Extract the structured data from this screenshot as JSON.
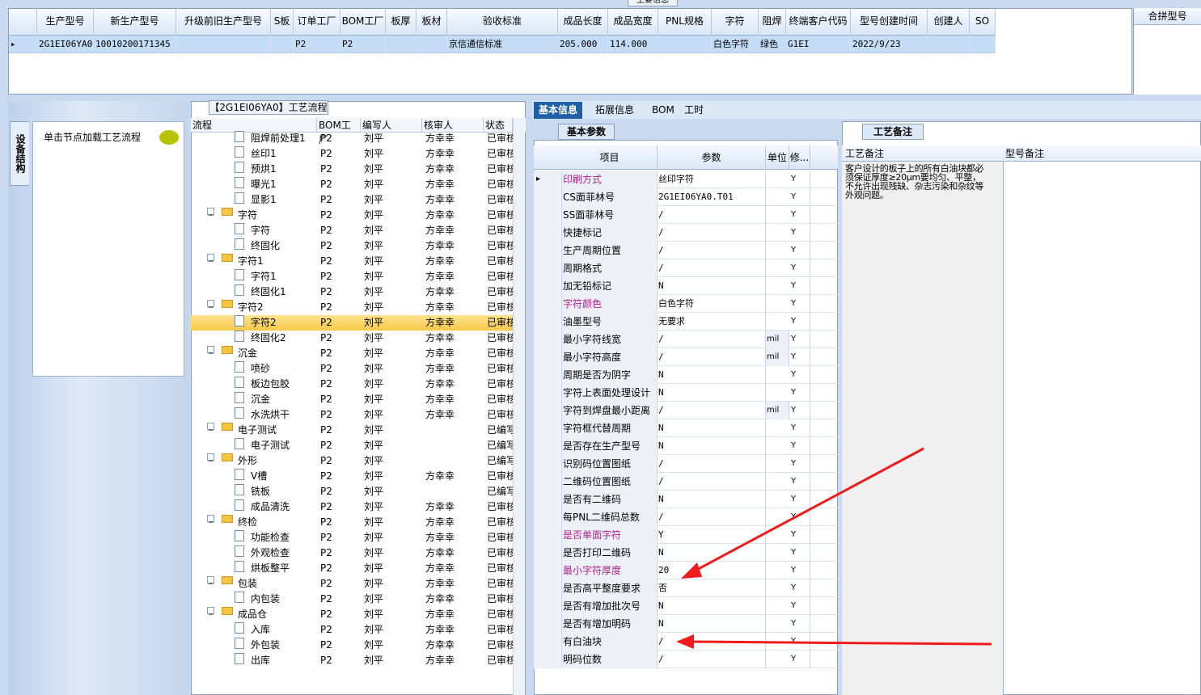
{
  "top_tab": "主要信息",
  "top_grid": {
    "columns": [
      "生产型号",
      "新生产型号",
      "升级前旧生产型号",
      "S板",
      "订单工厂",
      "BOM工厂",
      "板厚",
      "板材",
      "验收标准",
      "成品长度",
      "成品宽度",
      "PNL规格",
      "字符",
      "阻焊",
      "终端客户代码",
      "型号创建时间",
      "创建人",
      "SO"
    ],
    "row": [
      "2G1EI06YA0",
      "10010200171345",
      "",
      "",
      "P2",
      "P2",
      "",
      "",
      "京信通信标准",
      "205.000",
      "114.000",
      "",
      "白色字符",
      "绿色",
      "G1EI",
      "2022/9/23",
      "",
      ""
    ],
    "merge_header": "合拼型号"
  },
  "left_panel": {
    "vertical_tab": "设备结构",
    "node_text": "单击节点加载工艺流程"
  },
  "tree": {
    "title": "【2G1EI06YA0】工艺流程",
    "headers": [
      "流程",
      "BOM工厂",
      "编写人",
      "核审人",
      "状态"
    ],
    "rows": [
      {
        "name": "阻焊前处理1",
        "bom": "P2",
        "writer": "刘平",
        "reviewer": "方幸幸",
        "status": "已审核",
        "type": "leaf"
      },
      {
        "name": "丝印1",
        "bom": "P2",
        "writer": "刘平",
        "reviewer": "方幸幸",
        "status": "已审核",
        "type": "leaf"
      },
      {
        "name": "预烘1",
        "bom": "P2",
        "writer": "刘平",
        "reviewer": "方幸幸",
        "status": "已审核",
        "type": "leaf"
      },
      {
        "name": "曝光1",
        "bom": "P2",
        "writer": "刘平",
        "reviewer": "方幸幸",
        "status": "已审核",
        "type": "leaf"
      },
      {
        "name": "显影1",
        "bom": "P2",
        "writer": "刘平",
        "reviewer": "方幸幸",
        "status": "已审核",
        "type": "leaf"
      },
      {
        "name": "字符",
        "bom": "P2",
        "writer": "刘平",
        "reviewer": "方幸幸",
        "status": "已审核",
        "type": "folder"
      },
      {
        "name": "字符",
        "bom": "P2",
        "writer": "刘平",
        "reviewer": "方幸幸",
        "status": "已审核",
        "type": "leaf"
      },
      {
        "name": "终固化",
        "bom": "P2",
        "writer": "刘平",
        "reviewer": "方幸幸",
        "status": "已审核",
        "type": "leaf"
      },
      {
        "name": "字符1",
        "bom": "P2",
        "writer": "刘平",
        "reviewer": "方幸幸",
        "status": "已审核",
        "type": "folder"
      },
      {
        "name": "字符1",
        "bom": "P2",
        "writer": "刘平",
        "reviewer": "方幸幸",
        "status": "已审核",
        "type": "leaf"
      },
      {
        "name": "终固化1",
        "bom": "P2",
        "writer": "刘平",
        "reviewer": "方幸幸",
        "status": "已审核",
        "type": "leaf"
      },
      {
        "name": "字符2",
        "bom": "P2",
        "writer": "刘平",
        "reviewer": "方幸幸",
        "status": "已审核",
        "type": "folder"
      },
      {
        "name": "字符2",
        "bom": "P2",
        "writer": "刘平",
        "reviewer": "方幸幸",
        "status": "已审核",
        "type": "leaf",
        "selected": true
      },
      {
        "name": "终固化2",
        "bom": "P2",
        "writer": "刘平",
        "reviewer": "方幸幸",
        "status": "已审核",
        "type": "leaf"
      },
      {
        "name": "沉金",
        "bom": "P2",
        "writer": "刘平",
        "reviewer": "方幸幸",
        "status": "已审核",
        "type": "folder"
      },
      {
        "name": "喷砂",
        "bom": "P2",
        "writer": "刘平",
        "reviewer": "方幸幸",
        "status": "已审核",
        "type": "leaf"
      },
      {
        "name": "板边包胶",
        "bom": "P2",
        "writer": "刘平",
        "reviewer": "方幸幸",
        "status": "已审核",
        "type": "leaf"
      },
      {
        "name": "沉金",
        "bom": "P2",
        "writer": "刘平",
        "reviewer": "方幸幸",
        "status": "已审核",
        "type": "leaf"
      },
      {
        "name": "水洗烘干",
        "bom": "P2",
        "writer": "刘平",
        "reviewer": "方幸幸",
        "status": "已审核",
        "type": "leaf"
      },
      {
        "name": "电子测试",
        "bom": "P2",
        "writer": "刘平",
        "reviewer": "",
        "status": "已编写",
        "type": "folder"
      },
      {
        "name": "电子测试",
        "bom": "P2",
        "writer": "刘平",
        "reviewer": "",
        "status": "已编写",
        "type": "leaf"
      },
      {
        "name": "外形",
        "bom": "P2",
        "writer": "刘平",
        "reviewer": "",
        "status": "已编写",
        "type": "folder"
      },
      {
        "name": "V槽",
        "bom": "P2",
        "writer": "刘平",
        "reviewer": "方幸幸",
        "status": "已审核",
        "type": "leaf"
      },
      {
        "name": "铣板",
        "bom": "P2",
        "writer": "刘平",
        "reviewer": "",
        "status": "已编写",
        "type": "leaf"
      },
      {
        "name": "成品清洗",
        "bom": "P2",
        "writer": "刘平",
        "reviewer": "方幸幸",
        "status": "已审核",
        "type": "leaf"
      },
      {
        "name": "终检",
        "bom": "P2",
        "writer": "刘平",
        "reviewer": "方幸幸",
        "status": "已审核",
        "type": "folder"
      },
      {
        "name": "功能检查",
        "bom": "P2",
        "writer": "刘平",
        "reviewer": "方幸幸",
        "status": "已审核",
        "type": "leaf"
      },
      {
        "name": "外观检查",
        "bom": "P2",
        "writer": "刘平",
        "reviewer": "方幸幸",
        "status": "已审核",
        "type": "leaf"
      },
      {
        "name": "烘板整平",
        "bom": "P2",
        "writer": "刘平",
        "reviewer": "方幸幸",
        "status": "已审核",
        "type": "leaf"
      },
      {
        "name": "包装",
        "bom": "P2",
        "writer": "刘平",
        "reviewer": "方幸幸",
        "status": "已审核",
        "type": "folder"
      },
      {
        "name": "内包装",
        "bom": "P2",
        "writer": "刘平",
        "reviewer": "方幸幸",
        "status": "已审核",
        "type": "leaf"
      },
      {
        "name": "成品仓",
        "bom": "P2",
        "writer": "刘平",
        "reviewer": "方幸幸",
        "status": "已审核",
        "type": "folder"
      },
      {
        "name": "入库",
        "bom": "P2",
        "writer": "刘平",
        "reviewer": "方幸幸",
        "status": "已审核",
        "type": "leaf"
      },
      {
        "name": "外包装",
        "bom": "P2",
        "writer": "刘平",
        "reviewer": "方幸幸",
        "status": "已审核",
        "type": "leaf"
      },
      {
        "name": "出库",
        "bom": "P2",
        "writer": "刘平",
        "reviewer": "方幸幸",
        "status": "已审核",
        "type": "leaf"
      }
    ]
  },
  "tabs": [
    "基本信息",
    "拓展信息",
    "BOM",
    "工时"
  ],
  "sub_tab": "基本参数",
  "param_headers": [
    "项目",
    "参数",
    "单位",
    "修..."
  ],
  "params": [
    {
      "item": "印刷方式",
      "value": "丝印字符",
      "unit": "",
      "mod": "Y",
      "pink": true
    },
    {
      "item": "CS面菲林号",
      "value": "2G1EI06YA0.T01",
      "unit": "",
      "mod": "Y"
    },
    {
      "item": "SS面菲林号",
      "value": "/",
      "unit": "",
      "mod": "Y"
    },
    {
      "item": "快捷标记",
      "value": "/",
      "unit": "",
      "mod": "Y"
    },
    {
      "item": "生产周期位置",
      "value": "/",
      "unit": "",
      "mod": "Y"
    },
    {
      "item": "周期格式",
      "value": "/",
      "unit": "",
      "mod": "Y"
    },
    {
      "item": "加无铅标记",
      "value": "N",
      "unit": "",
      "mod": "Y"
    },
    {
      "item": "字符颜色",
      "value": "白色字符",
      "unit": "",
      "mod": "Y",
      "pink": true
    },
    {
      "item": "油墨型号",
      "value": "无要求",
      "unit": "",
      "mod": "Y"
    },
    {
      "item": "最小字符线宽",
      "value": "/",
      "unit": "mil",
      "mod": "Y"
    },
    {
      "item": "最小字符高度",
      "value": "/",
      "unit": "mil",
      "mod": "Y"
    },
    {
      "item": "周期是否为阴字",
      "value": "N",
      "unit": "",
      "mod": "Y"
    },
    {
      "item": "字符上表面处理设计",
      "value": "N",
      "unit": "",
      "mod": "Y"
    },
    {
      "item": "字符到焊盘最小距离",
      "value": "/",
      "unit": "mil",
      "mod": "Y"
    },
    {
      "item": "字符框代替周期",
      "value": "N",
      "unit": "",
      "mod": "Y"
    },
    {
      "item": "是否存在生产型号",
      "value": "N",
      "unit": "",
      "mod": "Y"
    },
    {
      "item": "识别码位置图纸",
      "value": "/",
      "unit": "",
      "mod": "Y"
    },
    {
      "item": "二维码位置图纸",
      "value": "/",
      "unit": "",
      "mod": "Y"
    },
    {
      "item": "是否有二维码",
      "value": "N",
      "unit": "",
      "mod": "Y"
    },
    {
      "item": "每PNL二维码总数",
      "value": "/",
      "unit": "",
      "mod": "Y"
    },
    {
      "item": "是否单面字符",
      "value": "Y",
      "unit": "",
      "mod": "Y",
      "pink": true
    },
    {
      "item": "是否打印二维码",
      "value": "N",
      "unit": "",
      "mod": "Y"
    },
    {
      "item": "最小字符厚度",
      "value": "20",
      "unit": "",
      "mod": "Y",
      "pink": true
    },
    {
      "item": "是否高平整度要求",
      "value": "否",
      "unit": "",
      "mod": "Y"
    },
    {
      "item": "是否有增加批次号",
      "value": "N",
      "unit": "",
      "mod": "Y"
    },
    {
      "item": "是否有增加明码",
      "value": "N",
      "unit": "",
      "mod": "Y"
    },
    {
      "item": "有白油块",
      "value": "/",
      "unit": "",
      "mod": "Y"
    },
    {
      "item": "明码位数",
      "value": "/",
      "unit": "",
      "mod": "Y"
    }
  ],
  "notes": {
    "tab": "工艺备注",
    "col1": "工艺备注",
    "col2": "型号备注",
    "text": "客户设计的板子上的所有白油块都必须保证厚度≥20μm要均匀、平整，不允许出现残缺、杂志污染和杂纹等外观问题。"
  },
  "colors": {
    "accent": "#1f5fa8",
    "selected_row": "#f7c94a",
    "arrow": "#ee1c1c",
    "pink_label": "#b01e8c"
  }
}
